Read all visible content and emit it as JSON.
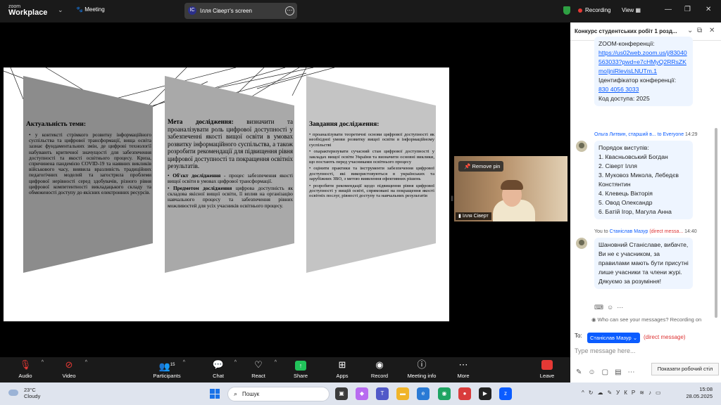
{
  "topbar": {
    "logo_top": "zoom",
    "logo_bottom": "Workplace",
    "meeting_label": "Meeting",
    "share_avatar": "ІС",
    "share_title": "Ілля Сіверт's screen",
    "recording_label": "Recording",
    "view_label": "View"
  },
  "slide": {
    "col1": {
      "title": "Актуальність теми:",
      "text": "у контексті стрімкого розвитку інформаційного суспільства та цифрової трансформації, вища освіта зазнає фундаментальних змін, де цифрові технології набувають критичної значущості для забезпечення доступності та якості освітнього процесу. Криза, спричинена пандемією COVID-19 та наявних викликів військового часу, виявила вразливість традиційних педагогічних моделей та загострила проблеми цифрової нерівності серед здобувачів, різного рівня цифрової компетентності викладацького складу та обмеженості доступу до якісних електронних ресурсів."
    },
    "col2": {
      "title_bold": "Мета дослідження:",
      "title_rest": " визначити та проаналізувати роль цифрової доступності у забезпеченні якості вищої освіти в умовах розвитку інформаційного суспільства, а також розробити рекомендації для підвищення рівня цифрової доступності та покращення освітніх результатів.",
      "object_bold": "Об'єкт дослідження",
      "object_rest": " - процес забезпечення якості вищої освіти в умовах цифрової трансформації.",
      "subject_bold": "Предметом дослідження",
      "subject_rest": " цифрова доступність як складова якісної вищої освіти, її вплив на організацію навчального процесу та забезпечення рівних можливостей для усіх учасників освітнього процесу."
    },
    "col3": {
      "title": "Завдання дослідження:",
      "items": [
        "проаналізувати теоретичні основи цифрової доступності як необхідної умови розвитку вищої освіти в інформаційному суспільстві",
        "охарактеризувати сучасний стан цифрової доступності у закладах вищої освіти України та визначити основні виклики, що постають перед учасниками освітнього процесу",
        "оцінити практики та інструменти забезпечення цифрової доступності, які використовуються в українських та зарубіжних ЗВО, з метою виявлення ефективних рішень",
        "розробити рекомендації щодо підвищення рівня цифрової доступності у вищій освіті, спрямовані на покращення якості освітніх послуг, рівності доступу та навчальних результатів"
      ]
    }
  },
  "video": {
    "remove_pin_label": "Remove pin",
    "participant_name": "Ілля Сіверт"
  },
  "toolbar": {
    "audio": "Audio",
    "video": "Video",
    "participants": "Participants",
    "participants_count": "15",
    "chat": "Chat",
    "react": "React",
    "share": "Share",
    "apps": "Apps",
    "record": "Record",
    "meeting_info": "Meeting info",
    "more": "More",
    "leave": "Leave"
  },
  "chat": {
    "header_title": "Конкурс студентських робіт 1 розд...",
    "msg1": {
      "line1": "ZOOM-конференції:",
      "link": "https://us02web.zoom.us/j/83040563033?pwd=e7cHMyQ2RRsZKmoIjniRlevisLNUTm.1",
      "id_label": "Ідентифікатор конференції:",
      "id_value": "830 4056 3033",
      "code": "Код доступа: 2025"
    },
    "msg2": {
      "sender": "Ольга Литвин, старший в...",
      "to": "to Everyone",
      "time": "14:29",
      "lines": [
        "Порядок виступів:",
        "1. Квасньовський Богдан",
        "2. Сіверт Ілля",
        "3. Муковоз Микола, Лебедєв Констянтин",
        "4. Клевець Вікторія",
        "5. Овод Олександр",
        "6. Батій Ігор, Магула Анна"
      ]
    },
    "msg3": {
      "sender_prefix": "You to",
      "sender_to": "Станіслав Мазур",
      "dm": "(direct messa...",
      "time": "14:40",
      "text": "Шановний Станіславе, вибачте, Ви не є учасником, за правилами мають бути присутні лише учасники та члени журі. Дякуємо за розуміння!"
    },
    "notice": "Who can see your messages? Recording on",
    "to_label": "To:",
    "recipient": "Станіслав Мазур",
    "direct_label": "(direct message)",
    "input_placeholder": "Type message here...",
    "tooltip": "Показати робочий стіл"
  },
  "taskbar": {
    "temp": "23°C",
    "weather": "Cloudy",
    "search_placeholder": "Пошук",
    "lang": "УКР",
    "time": "15:08",
    "date": "28.05.2025"
  },
  "colors": {
    "accent": "#0b5cff",
    "record_red": "#e53935",
    "shield_green": "#2ea043",
    "toolbar_bg": "#1a1a1a"
  }
}
